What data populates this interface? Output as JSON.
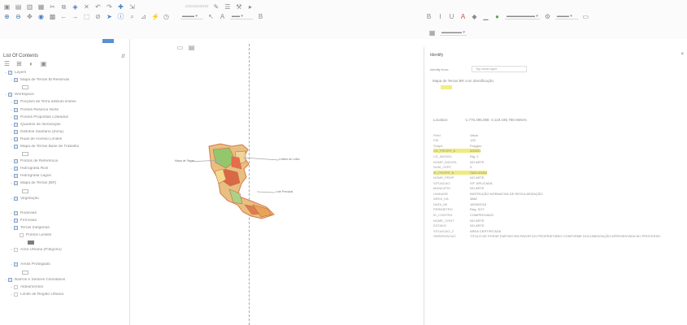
{
  "toolbar": {
    "top_icons": [
      "gear-icon",
      "pan-icon",
      "zoom-icon",
      "globe-icon",
      "layer-icon",
      "map-icon",
      "search-icon",
      "list-icon",
      "ruler-icon",
      "select-icon",
      "pointer-icon",
      "table-icon",
      "clear-icon",
      "refresh-icon"
    ],
    "left_text": "",
    "right_dd_1": "",
    "right_dd_2": "",
    "right_dd_3": "",
    "right_search": ""
  },
  "toc": {
    "title": "List Of Contents",
    "pin_icon": "pin-icon",
    "layers": [
      {
        "label": "Layers",
        "checked": true,
        "indent": 0,
        "swatch": ""
      },
      {
        "label": "Mapa de Terras Bi Reservas",
        "checked": true,
        "indent": 1,
        "swatch": ""
      },
      {
        "label": "",
        "checked": false,
        "indent": 2,
        "swatch": "#ffffff"
      },
      {
        "label": "Workspace",
        "checked": true,
        "indent": 0,
        "swatch": ""
      },
      {
        "label": "Porções de Terra atributo limites",
        "checked": true,
        "indent": 1,
        "swatch": ""
      },
      {
        "label": "Pontos Reserva Norte",
        "checked": true,
        "indent": 1,
        "swatch": ""
      },
      {
        "label": "Pontos Propostas Loteados",
        "checked": true,
        "indent": 1,
        "swatch": ""
      },
      {
        "label": "Quadros de Iluminação",
        "checked": true,
        "indent": 1,
        "swatch": ""
      },
      {
        "label": "Distritos Sanitário (Zona)",
        "checked": true,
        "indent": 1,
        "swatch": ""
      },
      {
        "label": "Ruas de Acesso Limites",
        "checked": true,
        "indent": 1,
        "swatch": ""
      },
      {
        "label": "Mapa de Terras Base de Trabalho",
        "checked": true,
        "indent": 1,
        "swatch": ""
      },
      {
        "label": "",
        "checked": false,
        "indent": 2,
        "swatch": "#ffffff"
      },
      {
        "label": "Pontos de Referência",
        "checked": true,
        "indent": 1,
        "swatch": ""
      },
      {
        "label": "Hidrografia Rios",
        "checked": true,
        "indent": 1,
        "swatch": ""
      },
      {
        "label": "Hidrografia Lagos",
        "checked": true,
        "indent": 1,
        "swatch": ""
      },
      {
        "label": "Mapa de Terras (BR)",
        "checked": true,
        "indent": 1,
        "swatch": ""
      },
      {
        "label": "",
        "checked": false,
        "indent": 2,
        "swatch": "#ffffff"
      },
      {
        "label": "Vegetação",
        "checked": true,
        "indent": 1,
        "swatch": ""
      },
      {
        "label": "",
        "checked": false,
        "indent": 2,
        "swatch": ""
      },
      {
        "label": "Rodovias",
        "checked": true,
        "indent": 1,
        "swatch": ""
      },
      {
        "label": "Ferrovias",
        "checked": true,
        "indent": 1,
        "swatch": ""
      },
      {
        "label": "Terras Indígenas",
        "checked": true,
        "indent": 1,
        "swatch": ""
      },
      {
        "label": "Pontos Limites",
        "checked": false,
        "indent": 2,
        "swatch": ""
      },
      {
        "label": "",
        "checked": false,
        "indent": 3,
        "swatch": "#7d7d7d"
      },
      {
        "label": "Área Urbana (Polígono)",
        "checked": false,
        "indent": 1,
        "swatch": ""
      },
      {
        "label": "",
        "checked": false,
        "indent": 2,
        "swatch": ""
      },
      {
        "label": "Áreas Protegidas",
        "checked": true,
        "indent": 1,
        "swatch": ""
      },
      {
        "label": "",
        "checked": false,
        "indent": 2,
        "swatch": "#ffffff"
      },
      {
        "label": "Bairros e Setores Censitários",
        "checked": true,
        "indent": 0,
        "swatch": ""
      },
      {
        "label": "Aldeamentos",
        "checked": false,
        "indent": 1,
        "swatch": ""
      },
      {
        "label": "Limite de Região Urbana",
        "checked": false,
        "indent": 1,
        "swatch": "#e0874d"
      }
    ]
  },
  "map": {
    "label_left": "Mapa de Terras",
    "label_right": "Limites de Lotes",
    "label_bottom": "Lote Principal"
  },
  "identify": {
    "title": "Identify",
    "close_icon": "close-icon",
    "from_label": "Identify from:",
    "from_value": "Top-most layer",
    "tree_node": "Mapa de Terras BR com Identificação",
    "selected_value": "",
    "location_label": "Location:",
    "location_value": "-1.775.495,088   -3.119.196,786 Meters",
    "fields": [
      {
        "k": "Field",
        "v": "Value",
        "hl": false
      },
      {
        "k": "FID",
        "v": "125",
        "hl": false
      },
      {
        "k": "Shape",
        "v": "Polygon",
        "hl": false
      },
      {
        "k": "CD_PROPR_B",
        "v": "000001",
        "hl": true
      },
      {
        "k": "CD_IMOVEL",
        "v": "Rig. 2",
        "hl": false
      },
      {
        "k": "NOME_IMOVEL",
        "v": "NO ARTE",
        "hl": false
      },
      {
        "k": "NUM_CERT",
        "v": "0",
        "hl": false
      },
      {
        "k": "ID_PROPR_B",
        "v": "SMS-00064",
        "hl": true
      },
      {
        "k": "NOME_PROP",
        "v": "NO ARTE",
        "hl": false
      },
      {
        "k": "SITUACAO",
        "v": "SIT. APLICADA",
        "hl": false
      },
      {
        "k": "MUNICIPIO",
        "v": "NO ARTE",
        "hl": false
      },
      {
        "k": "UNIDADE",
        "v": "INSTRUÇÃO NORMATIVA DE REGULARIZAÇÃO",
        "hl": false
      },
      {
        "k": "AREA_HA",
        "v": "4882",
        "hl": false
      },
      {
        "k": "DATA_INI",
        "v": "16/09/2016",
        "hl": false
      },
      {
        "k": "PERIMETRO",
        "v": "Reg. SOT",
        "hl": false
      },
      {
        "k": "ID_CONTRA",
        "v": "COMPROVADO",
        "hl": false
      },
      {
        "k": "NOME_CONT",
        "v": "NO ARTE",
        "hl": false
      },
      {
        "k": "ESTADO",
        "v": "NO ARTE",
        "hl": false
      },
      {
        "k": "SITUACAO_2",
        "v": "AREA CERTIFICADA",
        "hl": false
      },
      {
        "k": "OBSERVACAO",
        "v": "TITULO DE POSSE EMITIDO EM FAVOR DO PROPRIETÁRIO CONFORME DOCUMENTAÇÃO APRESENTADA NO PROCESSO",
        "hl": false
      }
    ]
  },
  "colors": {
    "accent_blue": "#5b8fd2",
    "highlight_yellow": "#f0eb7d",
    "map_orange": "#e0874d",
    "map_green": "#8ec96e"
  }
}
